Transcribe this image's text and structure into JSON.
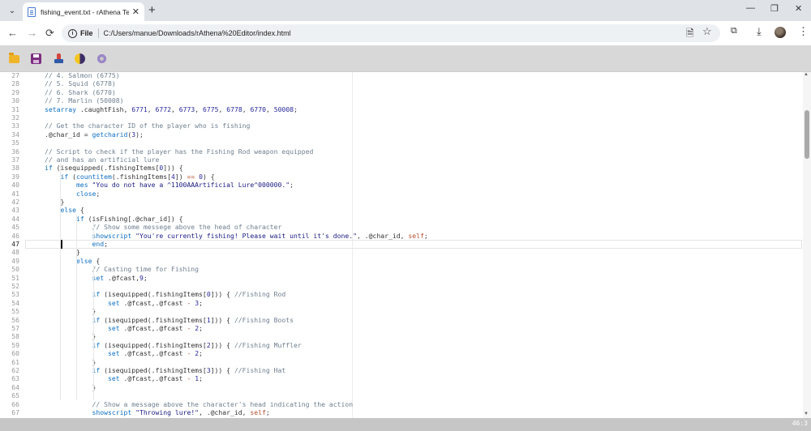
{
  "browser": {
    "tab_title": "fishing_event.txt - rAthena Text",
    "tab_close": "✕",
    "new_tab": "+",
    "omnibox_label": "File",
    "url": "C:/Users/manue/Downloads/rAthena%20Editor/index.html"
  },
  "icons": {
    "tab_menu": "chevron-down",
    "back": "←",
    "forward": "→",
    "reload": "⟳",
    "minimize": "—",
    "restore": "❐",
    "close": "✕",
    "page": "🗎",
    "star": "☆",
    "extension": "⧉",
    "download": "⤓",
    "more": "⋮"
  },
  "toolbar": [
    "open-folder",
    "save",
    "upload",
    "theme-toggle",
    "settings"
  ],
  "editor": {
    "current_line": 47,
    "lines": [
      {
        "n": 27,
        "parts": [
          [
            "c",
            "// 4. Salmon (6775)"
          ]
        ]
      },
      {
        "n": 28,
        "parts": [
          [
            "c",
            "// 5. Squid (6778)"
          ]
        ]
      },
      {
        "n": 29,
        "parts": [
          [
            "c",
            "// 6. Shark (6770)"
          ]
        ]
      },
      {
        "n": 30,
        "parts": [
          [
            "c",
            "// 7. Marlin (50008)"
          ]
        ]
      },
      {
        "n": 31,
        "parts": [
          [
            "k",
            "setarray"
          ],
          [
            "p",
            " .caughtFish, "
          ],
          [
            "n",
            "6771"
          ],
          [
            "p",
            ", "
          ],
          [
            "n",
            "6772"
          ],
          [
            "p",
            ", "
          ],
          [
            "n",
            "6773"
          ],
          [
            "p",
            ", "
          ],
          [
            "n",
            "6775"
          ],
          [
            "p",
            ", "
          ],
          [
            "n",
            "6778"
          ],
          [
            "p",
            ", "
          ],
          [
            "n",
            "6770"
          ],
          [
            "p",
            ", "
          ],
          [
            "n",
            "50008"
          ],
          [
            "p",
            ";"
          ]
        ]
      },
      {
        "n": 32,
        "parts": []
      },
      {
        "n": 33,
        "parts": [
          [
            "c",
            "// Get the character ID of the player who is fishing"
          ]
        ]
      },
      {
        "n": 34,
        "parts": [
          [
            "p",
            ".@char_id = "
          ],
          [
            "k",
            "getcharid"
          ],
          [
            "p",
            "("
          ],
          [
            "n",
            "3"
          ],
          [
            "p",
            ");"
          ]
        ]
      },
      {
        "n": 35,
        "parts": []
      },
      {
        "n": 36,
        "parts": [
          [
            "c",
            "// Script to check if the player has the Fishing Rod weapon equipped"
          ]
        ]
      },
      {
        "n": 37,
        "parts": [
          [
            "c",
            "// and has an artificial lure"
          ]
        ]
      },
      {
        "n": 38,
        "parts": [
          [
            "k",
            "if"
          ],
          [
            "p",
            " (isequipped(.fishingItems["
          ],
          [
            "n",
            "0"
          ],
          [
            "p",
            "])) {"
          ]
        ]
      },
      {
        "n": 39,
        "parts": [
          [
            "p",
            "    "
          ],
          [
            "k",
            "if"
          ],
          [
            "p",
            " ("
          ],
          [
            "k",
            "countitem"
          ],
          [
            "p",
            "(.fishingItems["
          ],
          [
            "n",
            "4"
          ],
          [
            "p",
            "]) "
          ],
          [
            "o",
            "=="
          ],
          [
            "p",
            " "
          ],
          [
            "n",
            "0"
          ],
          [
            "p",
            ") {"
          ]
        ]
      },
      {
        "n": 40,
        "parts": [
          [
            "p",
            "        "
          ],
          [
            "k",
            "mes"
          ],
          [
            "p",
            " "
          ],
          [
            "s",
            "\"You do not have a ^1100AAArtificial Lure^000000.\""
          ],
          [
            "p",
            ";"
          ]
        ]
      },
      {
        "n": 41,
        "parts": [
          [
            "p",
            "        "
          ],
          [
            "k",
            "close"
          ],
          [
            "p",
            ";"
          ]
        ]
      },
      {
        "n": 42,
        "parts": [
          [
            "p",
            "    }"
          ]
        ]
      },
      {
        "n": 43,
        "parts": [
          [
            "p",
            "    "
          ],
          [
            "k",
            "else"
          ],
          [
            "p",
            " {"
          ]
        ]
      },
      {
        "n": 44,
        "parts": [
          [
            "p",
            "        "
          ],
          [
            "k",
            "if"
          ],
          [
            "p",
            " (isFishing[.@char_id]) {"
          ]
        ]
      },
      {
        "n": 45,
        "parts": [
          [
            "p",
            "            "
          ],
          [
            "c",
            "// Show some messege above the head of character"
          ]
        ]
      },
      {
        "n": 46,
        "parts": [
          [
            "p",
            "            "
          ],
          [
            "k",
            "showscript"
          ],
          [
            "p",
            " "
          ],
          [
            "s",
            "\"You're currently fishing! Please wait until it's done.\""
          ],
          [
            "p",
            ", .@char_id, "
          ],
          [
            "o",
            "self"
          ],
          [
            "p",
            ";"
          ]
        ]
      },
      {
        "n": 47,
        "parts": [
          [
            "p",
            "            "
          ],
          [
            "k",
            "end"
          ],
          [
            "p",
            ";"
          ]
        ]
      },
      {
        "n": 48,
        "parts": [
          [
            "p",
            "        }"
          ]
        ]
      },
      {
        "n": 49,
        "parts": [
          [
            "p",
            "        "
          ],
          [
            "k",
            "else"
          ],
          [
            "p",
            " {"
          ]
        ]
      },
      {
        "n": 50,
        "parts": [
          [
            "p",
            "            "
          ],
          [
            "c",
            "// Casting time for Fishing"
          ]
        ]
      },
      {
        "n": 51,
        "parts": [
          [
            "p",
            "            "
          ],
          [
            "k",
            "set"
          ],
          [
            "p",
            " .@fcast,"
          ],
          [
            "n",
            "9"
          ],
          [
            "p",
            ";"
          ]
        ]
      },
      {
        "n": 52,
        "parts": []
      },
      {
        "n": 53,
        "parts": [
          [
            "p",
            "            "
          ],
          [
            "k",
            "if"
          ],
          [
            "p",
            " (isequipped(.fishingItems["
          ],
          [
            "n",
            "0"
          ],
          [
            "p",
            "])) { "
          ],
          [
            "c",
            "//Fishing Rod"
          ]
        ]
      },
      {
        "n": 54,
        "parts": [
          [
            "p",
            "                "
          ],
          [
            "k",
            "set"
          ],
          [
            "p",
            " .@fcast,.@fcast "
          ],
          [
            "o",
            "-"
          ],
          [
            "p",
            " "
          ],
          [
            "n",
            "3"
          ],
          [
            "p",
            ";"
          ]
        ]
      },
      {
        "n": 55,
        "parts": [
          [
            "p",
            "            }"
          ]
        ]
      },
      {
        "n": 56,
        "parts": [
          [
            "p",
            "            "
          ],
          [
            "k",
            "if"
          ],
          [
            "p",
            " (isequipped(.fishingItems["
          ],
          [
            "n",
            "1"
          ],
          [
            "p",
            "])) { "
          ],
          [
            "c",
            "//Fishing Boots"
          ]
        ]
      },
      {
        "n": 57,
        "parts": [
          [
            "p",
            "                "
          ],
          [
            "k",
            "set"
          ],
          [
            "p",
            " .@fcast,.@fcast "
          ],
          [
            "o",
            "-"
          ],
          [
            "p",
            " "
          ],
          [
            "n",
            "2"
          ],
          [
            "p",
            ";"
          ]
        ]
      },
      {
        "n": 58,
        "parts": [
          [
            "p",
            "            }"
          ]
        ]
      },
      {
        "n": 59,
        "parts": [
          [
            "p",
            "            "
          ],
          [
            "k",
            "if"
          ],
          [
            "p",
            " (isequipped(.fishingItems["
          ],
          [
            "n",
            "2"
          ],
          [
            "p",
            "])) { "
          ],
          [
            "c",
            "//Fishing Muffler"
          ]
        ]
      },
      {
        "n": 60,
        "parts": [
          [
            "p",
            "                "
          ],
          [
            "k",
            "set"
          ],
          [
            "p",
            " .@fcast,.@fcast "
          ],
          [
            "o",
            "-"
          ],
          [
            "p",
            " "
          ],
          [
            "n",
            "2"
          ],
          [
            "p",
            ";"
          ]
        ]
      },
      {
        "n": 61,
        "parts": [
          [
            "p",
            "            }"
          ]
        ]
      },
      {
        "n": 62,
        "parts": [
          [
            "p",
            "            "
          ],
          [
            "k",
            "if"
          ],
          [
            "p",
            " (isequipped(.fishingItems["
          ],
          [
            "n",
            "3"
          ],
          [
            "p",
            "])) { "
          ],
          [
            "c",
            "//Fishing Hat"
          ]
        ]
      },
      {
        "n": 63,
        "parts": [
          [
            "p",
            "                "
          ],
          [
            "k",
            "set"
          ],
          [
            "p",
            " .@fcast,.@fcast "
          ],
          [
            "o",
            "-"
          ],
          [
            "p",
            " "
          ],
          [
            "n",
            "1"
          ],
          [
            "p",
            ";"
          ]
        ]
      },
      {
        "n": 64,
        "parts": [
          [
            "p",
            "            }"
          ]
        ]
      },
      {
        "n": 65,
        "parts": []
      },
      {
        "n": 66,
        "parts": [
          [
            "p",
            "            "
          ],
          [
            "c",
            "// Show a message above the character's head indicating the action"
          ]
        ]
      },
      {
        "n": 67,
        "parts": [
          [
            "p",
            "            "
          ],
          [
            "k",
            "showscript"
          ],
          [
            "p",
            " "
          ],
          [
            "s",
            "\"Throwing lure!\""
          ],
          [
            "p",
            ", .@char_id, "
          ],
          [
            "o",
            "self"
          ],
          [
            "p",
            ";"
          ]
        ]
      }
    ]
  },
  "status": {
    "cursor_pos": "46:3"
  }
}
